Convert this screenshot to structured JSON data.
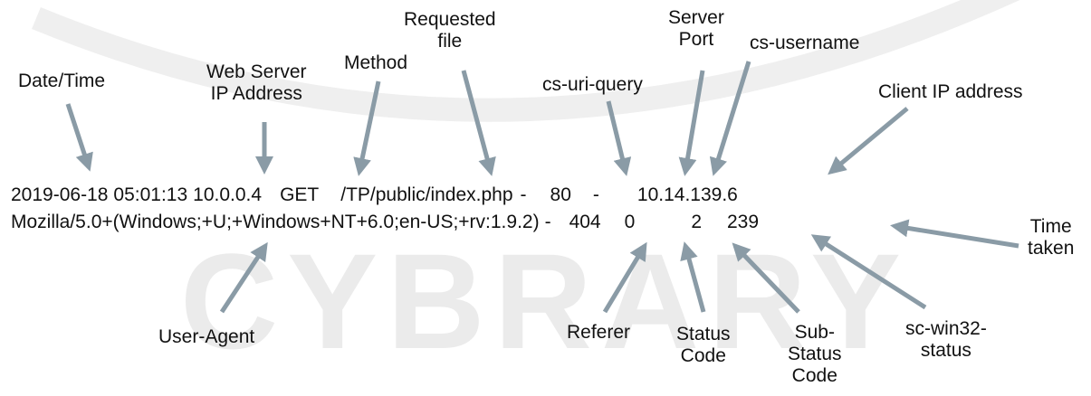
{
  "labels": {
    "date_time": "Date/Time",
    "web_server_ip_line1": "Web Server",
    "web_server_ip_line2": "IP Address",
    "method": "Method",
    "requested_file_line1": "Requested",
    "requested_file_line2": "file",
    "cs_uri_query": "cs-uri-query",
    "server_port_line1": "Server",
    "server_port_line2": "Port",
    "cs_username": "cs-username",
    "client_ip": "Client IP address",
    "time_taken_line1": "Time",
    "time_taken_line2": "taken",
    "user_agent": "User-Agent",
    "referer": "Referer",
    "status_code_line1": "Status",
    "status_code_line2": "Code",
    "sub_status_line1": "Sub-",
    "sub_status_line2": "Status",
    "sub_status_line3": "Code",
    "win32_status_line1": "sc-win32-",
    "win32_status_line2": "status"
  },
  "log": {
    "date": "2019-06-18",
    "time": "05:01:13",
    "server_ip": "10.0.0.4",
    "method": "GET",
    "uri_stem": "/TP/public/index.php",
    "uri_query": "-",
    "port": "80",
    "username": "-",
    "client_ip": "10.14.139.6",
    "user_agent": "Mozilla/5.0+(Windows;+U;+Windows+NT+6.0;en-US;+rv:1.9.2)",
    "referer": "-",
    "status": "404",
    "substatus": "0",
    "win32_status": "2",
    "time_taken": "239"
  },
  "watermark": {
    "text": "CYBRARY",
    "color": "#e9e9e9"
  },
  "colors": {
    "arrow": "#8a9ba6",
    "text": "#111111"
  }
}
